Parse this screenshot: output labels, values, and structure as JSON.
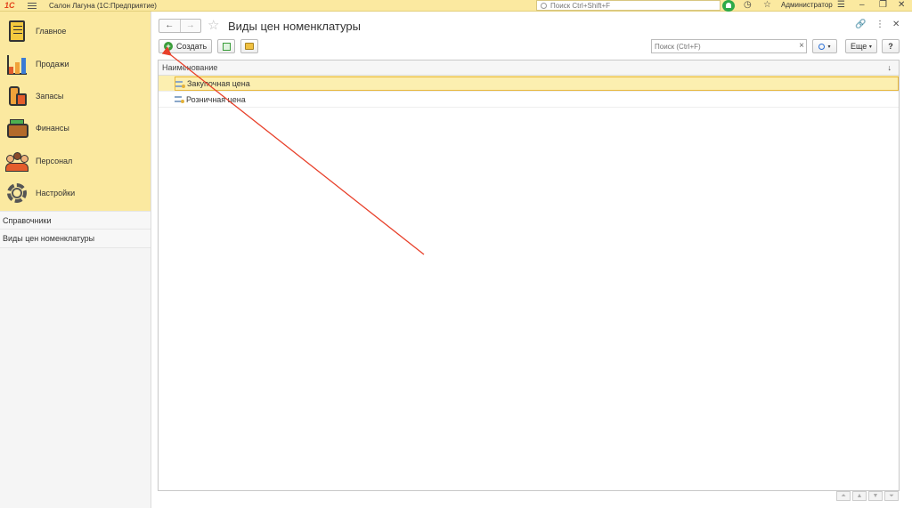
{
  "topbar": {
    "logo": "1С",
    "app_title": "Салон Лагуна  (1С:Предприятие)",
    "search_placeholder": "Поиск Ctrl+Shift+F",
    "user": "Администратор"
  },
  "sidebar": {
    "sections": [
      {
        "label": "Главное",
        "icon": "clipboard-icon"
      },
      {
        "label": "Продажи",
        "icon": "sales-chart-icon"
      },
      {
        "label": "Запасы",
        "icon": "stock-icon"
      },
      {
        "label": "Финансы",
        "icon": "wallet-icon"
      },
      {
        "label": "Персонал",
        "icon": "staff-icon"
      },
      {
        "label": "Настройки",
        "icon": "gear-icon"
      }
    ],
    "links": [
      "Справочники",
      "Виды цен номенклатуры"
    ]
  },
  "main": {
    "title": "Виды цен номенклатуры",
    "create_label": "Создать",
    "search_placeholder": "Поиск (Ctrl+F)",
    "more_label": "Еще",
    "help_label": "?",
    "column_header": "Наименование",
    "rows": [
      "Закупочная цена",
      "Розничная цена"
    ],
    "selected_row": 0
  },
  "colors": {
    "accent": "#fbe9a0",
    "selection": "#fcefb0",
    "annotation_arrow": "#e8402a",
    "create_icon": "#3a9d3a"
  }
}
